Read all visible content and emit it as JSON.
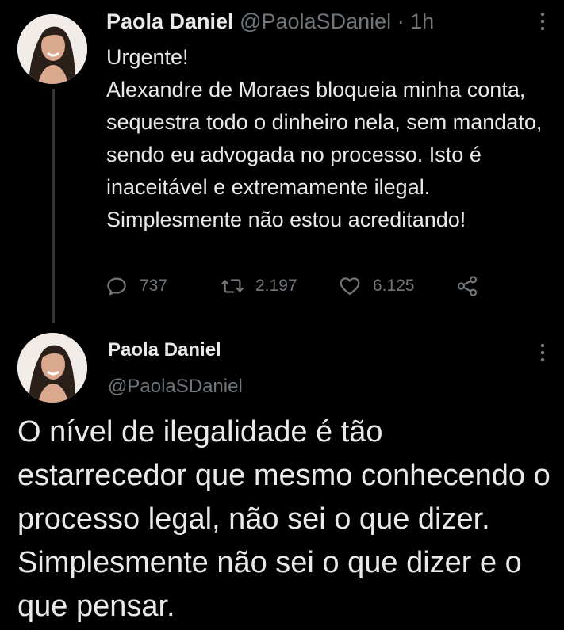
{
  "tweet1": {
    "display_name": "Paola Daniel",
    "handle": "@PaolaSDaniel",
    "separator": "·",
    "time": "1h",
    "text_heading": "Urgente!",
    "text_body": "Alexandre de Moraes bloqueia minha conta, sequestra todo o dinheiro nela, sem mandato, sendo eu advogada no processo. Isto é inaceitável e extremamente ilegal. Simplesmente não estou acreditando!",
    "actions": {
      "replies_icon": "reply-icon",
      "replies": "737",
      "retweets_icon": "retweet-icon",
      "retweets": "2.197",
      "likes_icon": "heart-icon",
      "likes": "6.125",
      "share_icon": "share-icon"
    }
  },
  "tweet2": {
    "display_name": "Paola Daniel",
    "handle": "@PaolaSDaniel",
    "text": "O nível de ilegalidade é tão estarrecedor que mesmo conhecendo o processo legal, não sei o que dizer. Simplesmente não sei o que dizer e o que pensar."
  },
  "colors": {
    "background": "#000000",
    "text_primary": "#e7e9ea",
    "text_secondary": "#71767b",
    "thread_line": "#333639"
  },
  "icons": {
    "more": "more-vertical-icon",
    "avatar": "avatar-photo"
  }
}
